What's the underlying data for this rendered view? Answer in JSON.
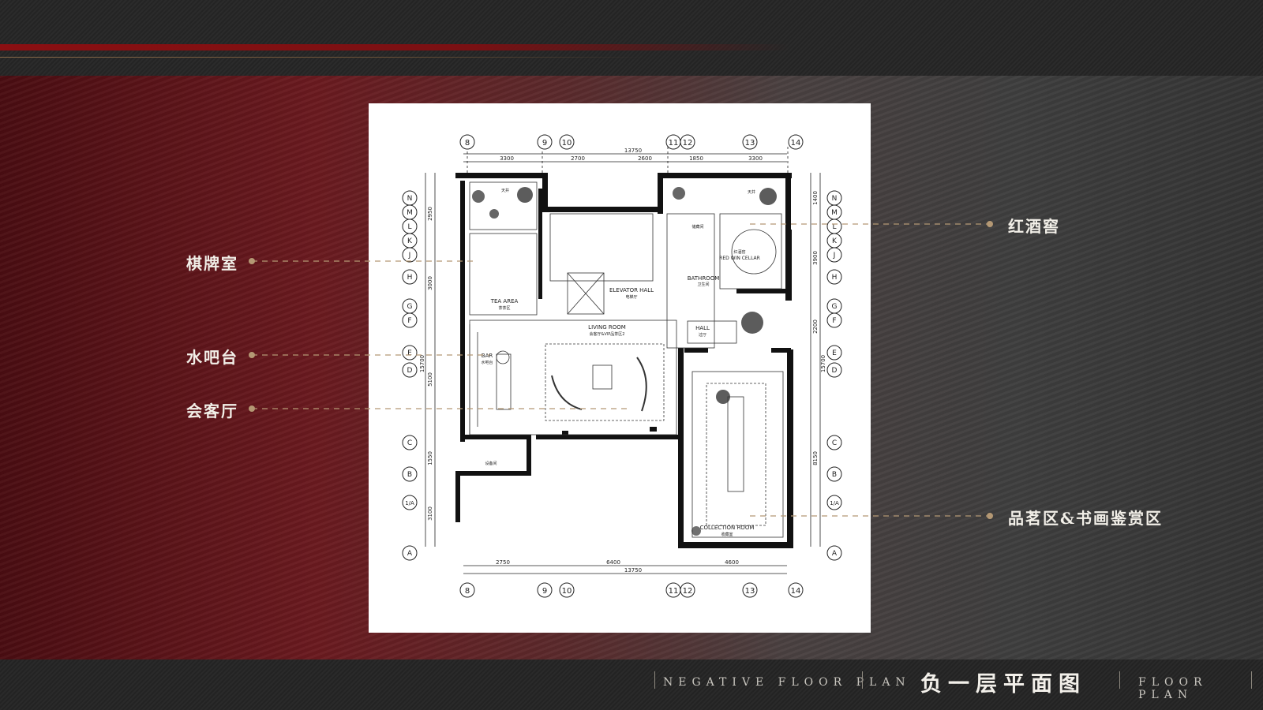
{
  "callouts": {
    "chess_room": "棋牌室",
    "water_bar": "水吧台",
    "reception_hall": "会客厅",
    "wine_cellar": "红酒窖",
    "tea_art_area": "品茗区&书画鉴赏区"
  },
  "footer": {
    "left_label": "NEGATIVE FLOOR PLAN",
    "title": "负一层平面图",
    "right_label": "FLOOR PLAN"
  },
  "plan": {
    "top_grid": [
      "8",
      "9",
      "10",
      "11",
      "12",
      "13",
      "14"
    ],
    "bottom_grid": [
      "8",
      "9",
      "10",
      "11",
      "12",
      "13",
      "14"
    ],
    "side_grid": [
      "N",
      "M",
      "L",
      "K",
      "J",
      "H",
      "G",
      "F",
      "E",
      "D",
      "C",
      "B",
      "1/A",
      "A"
    ],
    "top_dims": [
      "3300",
      "2700",
      "2600",
      "1850",
      "3300"
    ],
    "top_total": "13750",
    "bottom_dims": [
      "2750",
      "6400",
      "4600"
    ],
    "bottom_total": "13750",
    "left_dims": [
      "2950",
      "3000",
      "5100",
      "1550",
      "3100"
    ],
    "left_total": "15700",
    "right_dims": [
      "1400",
      "3900",
      "2200",
      "8150"
    ],
    "right_total": "15700",
    "room_labels": {
      "tea_area": "TEA AREA",
      "tea_area_cn": "茶茶区",
      "elevator_hall": "ELEVATOR HALL",
      "elevator_hall_cn": "电梯厅",
      "living_room": "LIVING ROOM",
      "living_room_cn": "会客厅&VIP品茶区2",
      "bar": "BAR",
      "bar_cn": "水吧台",
      "bathroom": "BATHROOM",
      "bathroom_cn": "卫生间",
      "hall": "HALL",
      "hall_cn": "过厅",
      "red_wine_cellar": "RED WIN CELLAR",
      "red_wine_cellar_cn": "红酒窖",
      "collection_room": "COLLECTION ROOM",
      "collection_room_cn": "收藏室",
      "sky_well_1": "天井",
      "sky_well_2": "天井",
      "storage": "储藏间",
      "equipment": "设备间"
    }
  }
}
